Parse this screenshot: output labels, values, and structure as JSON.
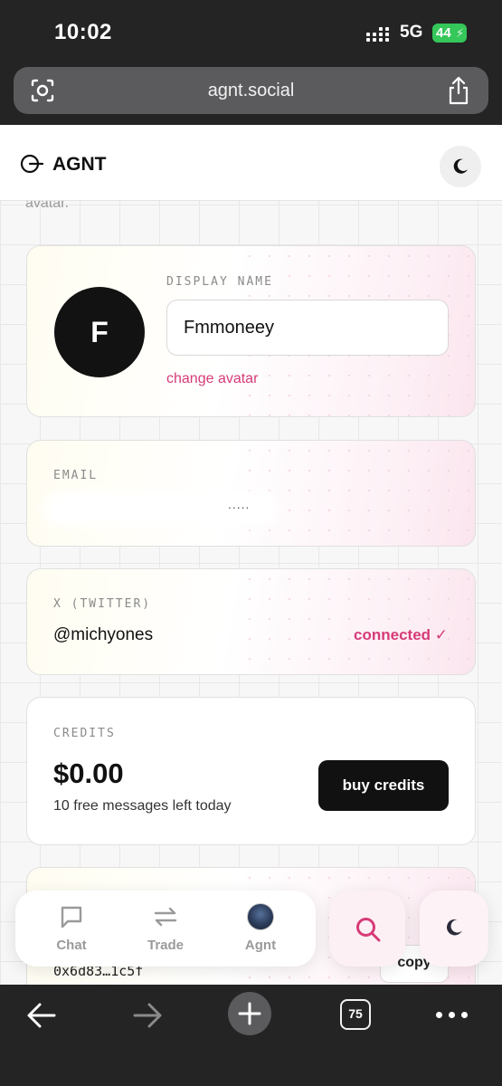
{
  "status_bar": {
    "time": "10:02",
    "network": "5G",
    "battery": "44"
  },
  "browser": {
    "url": "agnt.social",
    "tab_count": "75"
  },
  "header": {
    "brand": "AGNT",
    "logo_icon": "agnt-logo-icon",
    "theme_icon": "moon-icon"
  },
  "profile": {
    "cut_text": "avatar.",
    "avatar_initial": "F",
    "display_name_label": "DISPLAY NAME",
    "display_name_value": "Fmmoneey",
    "change_avatar": "change avatar",
    "email_label": "EMAIL",
    "email_partial": ".....",
    "x_label": "X (TWITTER)",
    "x_handle": "@michyones",
    "x_status": "connected ✓",
    "credits_label": "CREDITS",
    "credits_value": "$0.00",
    "credits_sub": "10 free messages left today",
    "buy_button": "buy credits",
    "wallet_address": "0x6d83…1c5f",
    "copy_button": "copy"
  },
  "nav": {
    "items": [
      {
        "label": "Chat",
        "icon": "chat-bubble-icon"
      },
      {
        "label": "Trade",
        "icon": "swap-arrows-icon"
      },
      {
        "label": "Agnt",
        "icon": "agent-avatar-icon"
      }
    ],
    "search_icon": "search-icon",
    "theme_icon": "moon-icon"
  },
  "colors": {
    "accent": "#d63b78",
    "dark": "#111111",
    "chrome": "#242424",
    "battery": "#35c759"
  }
}
